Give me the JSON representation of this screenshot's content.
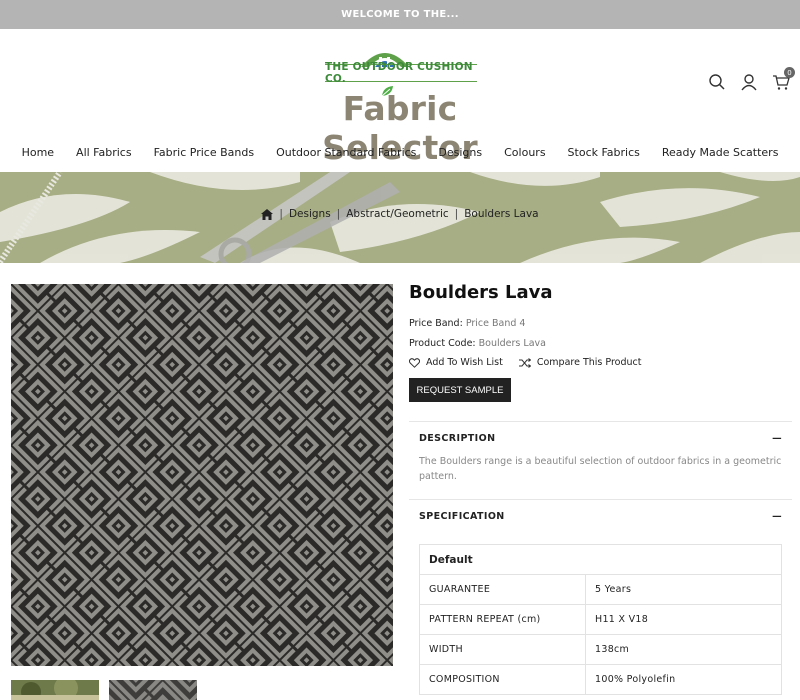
{
  "topbar": {
    "text": "WELCOME TO THE..."
  },
  "logo": {
    "company": "THE OUTDOOR CUSHION CO.",
    "title": "Fabric Selector"
  },
  "header": {
    "cart_count": "0"
  },
  "nav": [
    "Home",
    "All Fabrics",
    "Fabric Price Bands",
    "Outdoor Standard Fabrics",
    "Designs",
    "Colours",
    "Stock Fabrics",
    "Ready Made Scatters"
  ],
  "breadcrumb": [
    "Designs",
    "Abstract/Geometric",
    "Boulders Lava"
  ],
  "product": {
    "title": "Boulders Lava",
    "price_band_label": "Price Band:",
    "price_band_value": "Price Band 4",
    "code_label": "Product Code:",
    "code_value": "Boulders Lava",
    "wishlist": "Add To Wish List",
    "compare": "Compare This Product",
    "request_sample": "REQUEST SAMPLE"
  },
  "description": {
    "heading": "DESCRIPTION",
    "text": "The Boulders range is a beautiful selection of outdoor fabrics in a geometric pattern."
  },
  "specification": {
    "heading": "SPECIFICATION",
    "group": "Default",
    "rows": [
      {
        "label": "GUARANTEE",
        "value": "5 Years"
      },
      {
        "label": "PATTERN REPEAT (cm)",
        "value": "H11 X V18"
      },
      {
        "label": "WIDTH",
        "value": "138cm"
      },
      {
        "label": "COMPOSITION",
        "value": "100% Polyolefin"
      }
    ]
  },
  "colors": {
    "topbar": "#b4b4b4",
    "logo_green": "#3c8a3a",
    "logo_grey": "#8c8574",
    "button": "#222222",
    "fabric_dark": "#2b2a28",
    "fabric_light": "#8f8e89"
  }
}
